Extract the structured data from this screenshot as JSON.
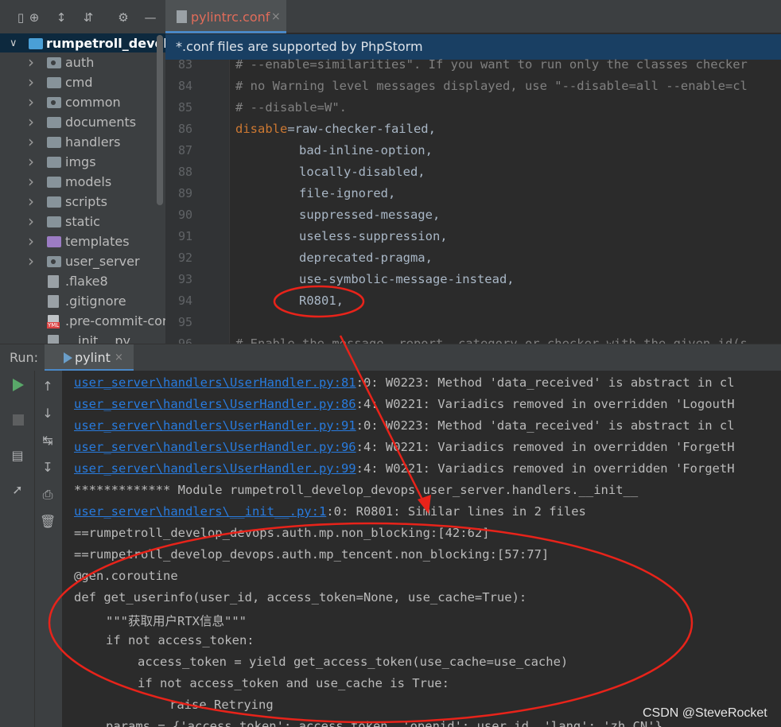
{
  "project": {
    "root_label": "rumpetroll_develo",
    "items": [
      {
        "label": "auth",
        "type": "package"
      },
      {
        "label": "cmd",
        "type": "folder"
      },
      {
        "label": "common",
        "type": "package"
      },
      {
        "label": "documents",
        "type": "folder"
      },
      {
        "label": "handlers",
        "type": "folder"
      },
      {
        "label": "imgs",
        "type": "folder"
      },
      {
        "label": "models",
        "type": "folder"
      },
      {
        "label": "scripts",
        "type": "folder"
      },
      {
        "label": "static",
        "type": "folder"
      },
      {
        "label": "templates",
        "type": "folder-purple"
      },
      {
        "label": "user_server",
        "type": "package"
      },
      {
        "label": ".flake8",
        "type": "file"
      },
      {
        "label": ".gitignore",
        "type": "file"
      },
      {
        "label": ".pre-commit-cor",
        "type": "yml"
      },
      {
        "label": "__init__.py",
        "type": "file"
      }
    ]
  },
  "editor": {
    "tab_label": "pylintrc.conf",
    "tab_close": "×",
    "banner": "*.conf files are supported by PhpStorm",
    "lines": [
      {
        "n": "83",
        "text": "# --enable=similarities\". If you want to run only the classes checker"
      },
      {
        "n": "84",
        "text": "# no Warning level messages displayed, use \"--disable=all --enable=cl"
      },
      {
        "n": "85",
        "text": "# --disable=W\"."
      },
      {
        "n": "86",
        "key": "disable",
        "text": "=raw-checker-failed,"
      },
      {
        "n": "87",
        "text": "bad-inline-option,"
      },
      {
        "n": "88",
        "text": "locally-disabled,"
      },
      {
        "n": "89",
        "text": "file-ignored,"
      },
      {
        "n": "90",
        "text": "suppressed-message,"
      },
      {
        "n": "91",
        "text": "useless-suppression,"
      },
      {
        "n": "92",
        "text": "deprecated-pragma,"
      },
      {
        "n": "93",
        "text": "use-symbolic-message-instead,"
      },
      {
        "n": "94",
        "text": "R0801,"
      },
      {
        "n": "95",
        "text": ""
      },
      {
        "n": "96",
        "text": "# Enable the message, report, category or checker with the given id(s"
      }
    ]
  },
  "run": {
    "label": "Run:",
    "tab_label": "pylint",
    "tab_close": "×",
    "console": [
      {
        "link": "user_server\\handlers\\UserHandler.py:81",
        "text": ":0: W0223: Method 'data_received' is abstract in cl"
      },
      {
        "link": "user_server\\handlers\\UserHandler.py:86",
        "text": ":4: W0221: Variadics removed in overridden 'LogoutH"
      },
      {
        "link": "user_server\\handlers\\UserHandler.py:91",
        "text": ":0: W0223: Method 'data_received' is abstract in cl"
      },
      {
        "link": "user_server\\handlers\\UserHandler.py:96",
        "text": ":4: W0221: Variadics removed in overridden 'ForgetH"
      },
      {
        "link": "user_server\\handlers\\UserHandler.py:99",
        "text": ":4: W0221: Variadics removed in overridden 'ForgetH"
      },
      {
        "link": "",
        "text": "************* Module rumpetroll_develop_devops.user_server.handlers.__init__"
      },
      {
        "link": "user_server\\handlers\\__init__.py:1",
        "text": ":0: R0801: Similar lines in 2 files"
      },
      {
        "link": "",
        "text": "==rumpetroll_develop_devops.auth.mp.non_blocking:[42:62]"
      },
      {
        "link": "",
        "text": "==rumpetroll_develop_devops.auth.mp_tencent.non_blocking:[57:77]"
      },
      {
        "link": "",
        "text": "@gen.coroutine"
      },
      {
        "link": "",
        "text": "def get_userinfo(user_id, access_token=None, use_cache=True):"
      },
      {
        "link": "",
        "text": "\"\"\"获取用户RTX信息\"\"\"",
        "indent": 1
      },
      {
        "link": "",
        "text": "if not access_token:",
        "indent": 1
      },
      {
        "link": "",
        "text": "access_token = yield get_access_token(use_cache=use_cache)",
        "indent": 2
      },
      {
        "link": "",
        "text": "if not access_token and use_cache is True:",
        "indent": 2
      },
      {
        "link": "",
        "text": "raise Retrying",
        "indent": 3
      },
      {
        "link": "",
        "text": "params = {'access_token': access_token, 'openid': user_id, 'lang': 'zh_CN'}",
        "indent": 1
      }
    ]
  },
  "watermark": "CSDN @SteveRocket",
  "colors": {
    "annotation": "#e8231a",
    "link": "#287bde",
    "keyword": "#cc7832"
  }
}
